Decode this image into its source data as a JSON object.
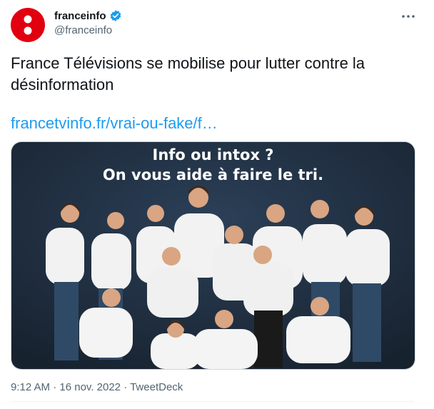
{
  "account": {
    "display_name": "franceinfo",
    "handle": "@franceinfo",
    "verified": true,
    "avatar_color": "#e1000f"
  },
  "tweet": {
    "text": "France Télévisions se mobilise pour lutter contre la désinformation",
    "link_text": "francetvinfo.fr/vrai-ou-fake/f…",
    "link_color": "#1d9bf0"
  },
  "media": {
    "headline_line1": "Info ou intox ?",
    "headline_line2": "On vous aide à faire le tri.",
    "background_color": "#1e2d3f"
  },
  "meta": {
    "time": "9:12 AM",
    "separator1": " · ",
    "date": "16 nov. 2022",
    "separator2": " · ",
    "source": "TweetDeck"
  }
}
